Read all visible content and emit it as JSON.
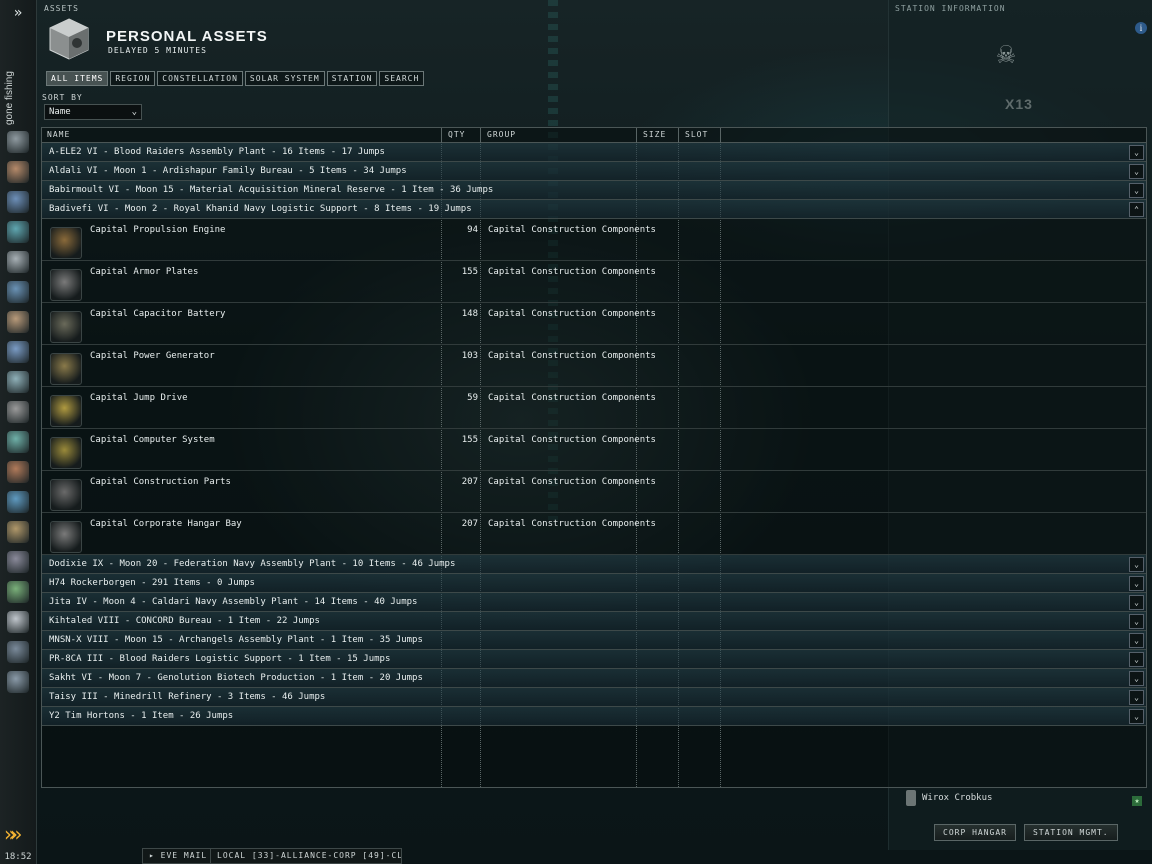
{
  "sidebar": {
    "status": "gone fishing",
    "time": "18:52",
    "icons": [
      "character-icon",
      "neocom-icon",
      "mail-icon",
      "people-icon",
      "market-icon",
      "ship-icon",
      "journal-icon",
      "map-icon",
      "skills-icon",
      "assets-icon",
      "science-icon",
      "corporation-icon",
      "browser-icon",
      "notepad-icon",
      "music-icon",
      "help-icon",
      "portrait-icon",
      "fleet-icon",
      "station-icon"
    ]
  },
  "assets": {
    "window_title": "ASSETS",
    "header": "PERSONAL ASSETS",
    "subheader": "DELAYED 5 MINUTES",
    "tabs": [
      "ALL ITEMS",
      "REGION",
      "CONSTELLATION",
      "SOLAR SYSTEM",
      "STATION",
      "SEARCH"
    ],
    "sort_by_label": "SORT BY",
    "sort_by_value": "Name",
    "columns": [
      "NAME",
      "QTY",
      "GROUP",
      "SIZE",
      "SLOT"
    ],
    "groups_before": [
      {
        "label": "A-ELE2 VI - Blood Raiders Assembly Plant - 16 Items - 17 Jumps"
      },
      {
        "label": "Aldali VI - Moon 1 - Ardishapur Family Bureau - 5 Items - 34 Jumps"
      },
      {
        "label": "Babirmoult VI - Moon 15 - Material Acquisition Mineral Reserve - 1 Item - 36 Jumps"
      },
      {
        "label": "Badivefi VI - Moon 2 - Royal Khanid Navy Logistic Support - 8 Items - 19 Jumps"
      }
    ],
    "items": [
      {
        "name": "Capital Propulsion Engine",
        "qty": "94",
        "group": "Capital Construction Components"
      },
      {
        "name": "Capital Armor Plates",
        "qty": "155",
        "group": "Capital Construction Components"
      },
      {
        "name": "Capital Capacitor Battery",
        "qty": "148",
        "group": "Capital Construction Components"
      },
      {
        "name": "Capital Power Generator",
        "qty": "103",
        "group": "Capital Construction Components"
      },
      {
        "name": "Capital Jump Drive",
        "qty": "59",
        "group": "Capital Construction Components"
      },
      {
        "name": "Capital Computer System",
        "qty": "155",
        "group": "Capital Construction Components"
      },
      {
        "name": "Capital Construction Parts",
        "qty": "207",
        "group": "Capital Construction Components"
      },
      {
        "name": "Capital Corporate Hangar Bay",
        "qty": "207",
        "group": "Capital Construction Components"
      }
    ],
    "groups_after": [
      {
        "label": "Dodixie IX - Moon 20 - Federation Navy Assembly Plant - 10 Items - 46 Jumps"
      },
      {
        "label": "H74 Rockerborgen - 291 Items - 0 Jumps"
      },
      {
        "label": "Jita IV - Moon 4 - Caldari Navy Assembly Plant - 14 Items - 40 Jumps"
      },
      {
        "label": "Kihtaled VIII - CONCORD Bureau - 1 Item - 22 Jumps"
      },
      {
        "label": "MNSN-X VIII - Moon 15 - Archangels Assembly Plant - 1 Item - 35 Jumps"
      },
      {
        "label": "PR-8CA III - Blood Raiders Logistic Support - 1 Item - 15 Jumps"
      },
      {
        "label": "Sakht VI - Moon 7 - Genolution Biotech Production - 1 Item - 20 Jumps"
      },
      {
        "label": "Taisy III - Minedrill Refinery - 3 Items - 46 Jumps"
      },
      {
        "label": "Y2 Tim Hortons - 1 Item - 26 Jumps"
      }
    ]
  },
  "station": {
    "title": "STATION INFORMATION",
    "name": "X13",
    "pilot": "Wirox Crobkus",
    "buttons": [
      "CORP HANGAR",
      "STATION MGMT."
    ]
  },
  "taskbar": {
    "mail": "EVE MAIL",
    "local": "LOCAL [33]-ALLIANCE-CORP [49]-CL..."
  },
  "colors": {
    "group_row": "#2b4650",
    "accent_chevron": "#f2b233"
  }
}
